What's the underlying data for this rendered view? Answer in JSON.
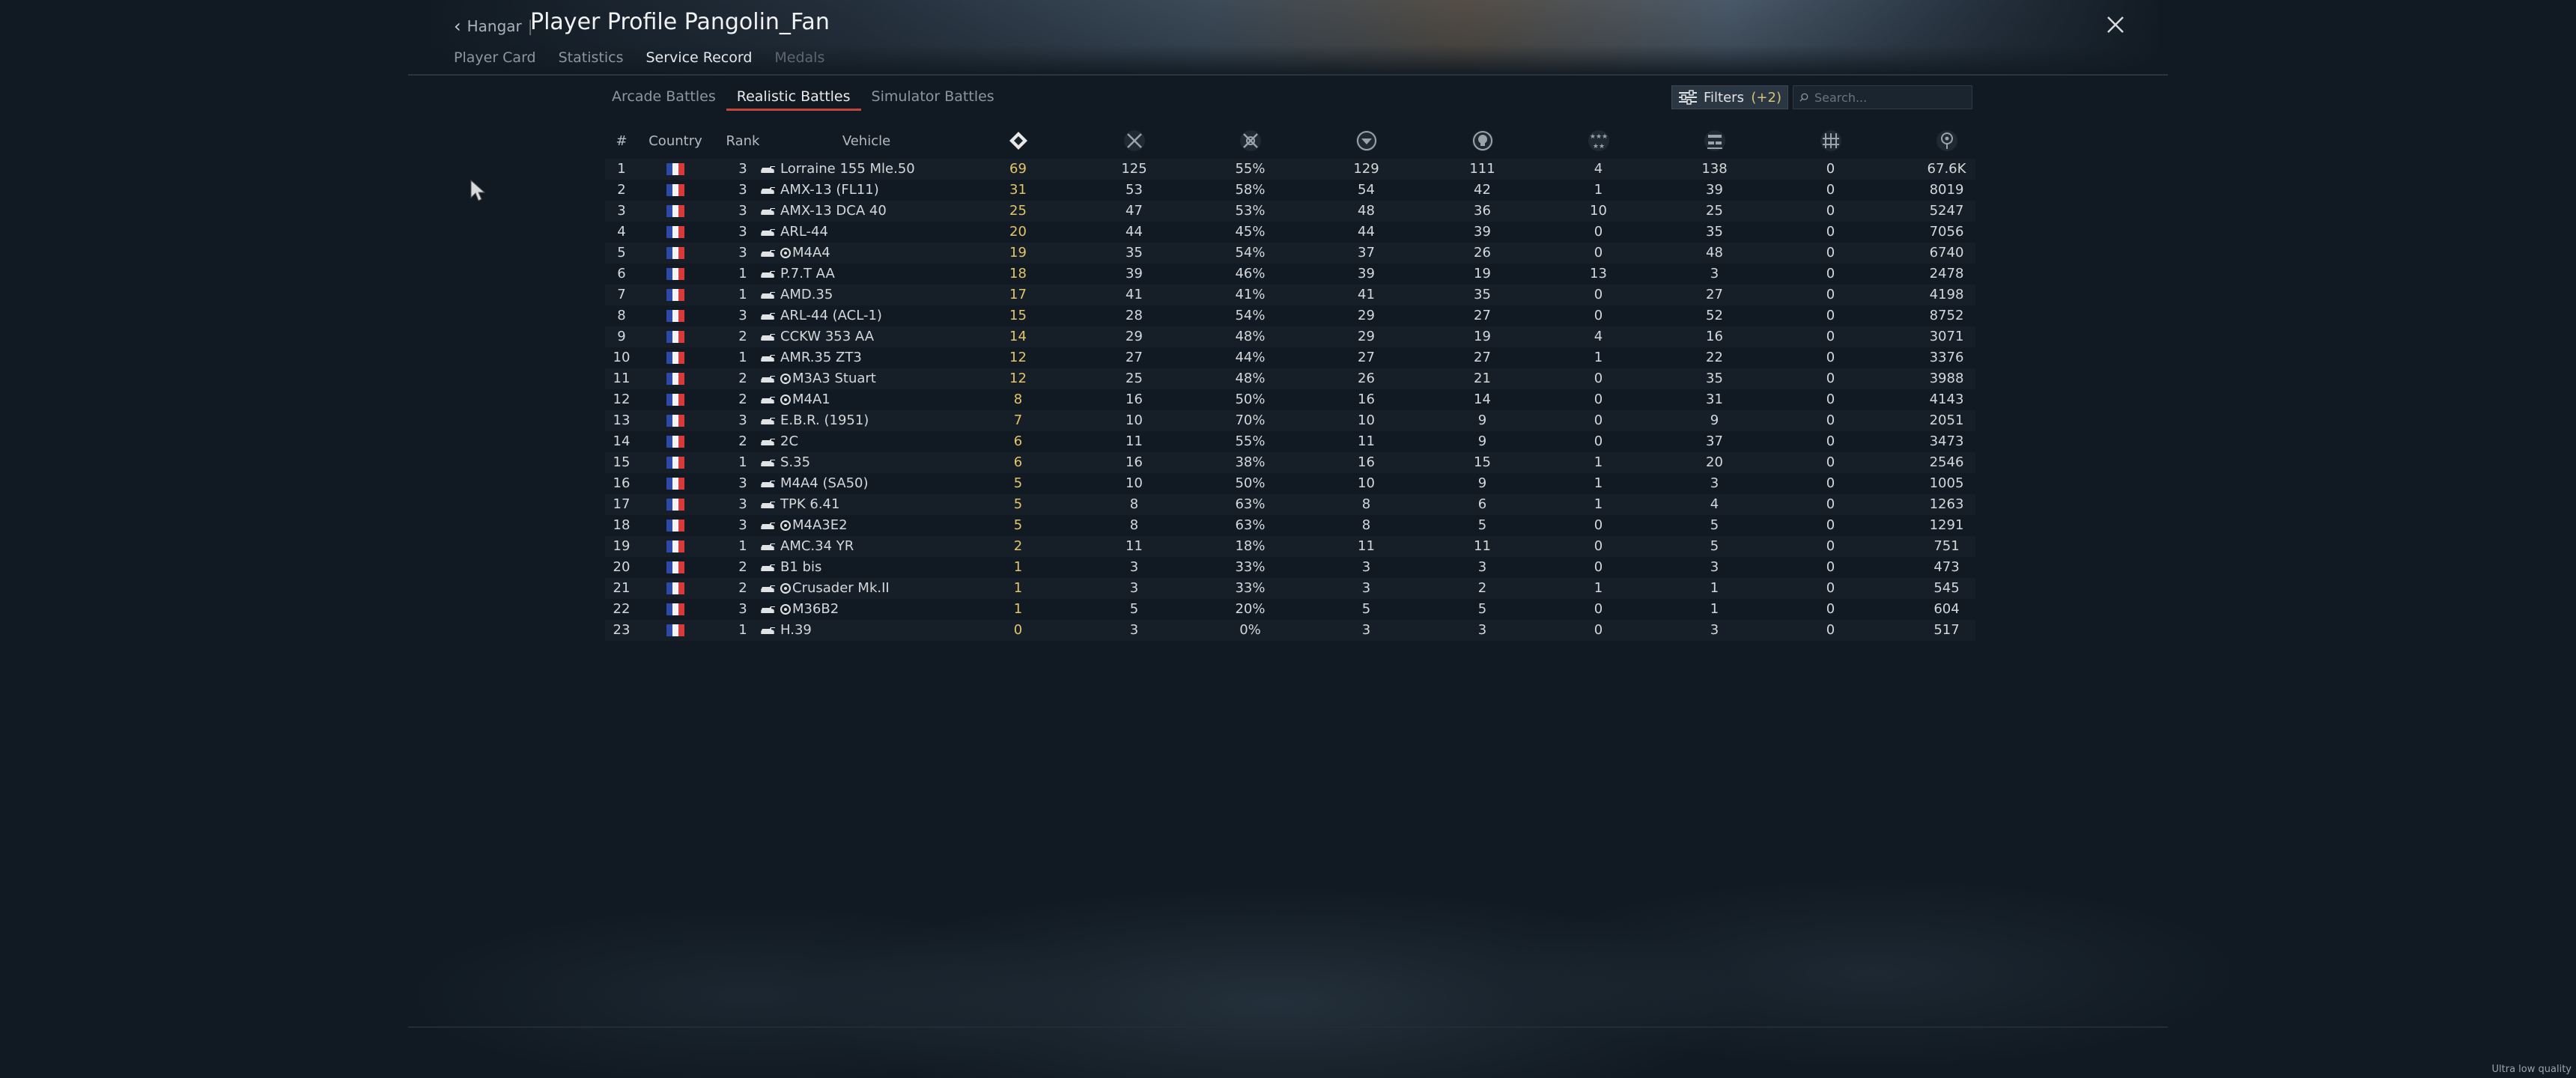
{
  "header": {
    "back_label": "Hangar",
    "title": "Player Profile Pangolin_Fan"
  },
  "tabs": [
    {
      "label": "Player Card",
      "state": "normal"
    },
    {
      "label": "Statistics",
      "state": "normal"
    },
    {
      "label": "Service Record",
      "state": "active"
    },
    {
      "label": "Medals",
      "state": "dim"
    }
  ],
  "battle_tabs": [
    {
      "label": "Arcade Battles",
      "active": false
    },
    {
      "label": "Realistic Battles",
      "active": true
    },
    {
      "label": "Simulator Battles",
      "active": false
    }
  ],
  "filters": {
    "label": "Filters",
    "count": "(+2)"
  },
  "search": {
    "placeholder": "Search..."
  },
  "table": {
    "headers": {
      "num": "#",
      "country": "Country",
      "rank": "Rank",
      "vehicle": "Vehicle"
    },
    "icon_columns": [
      "battles-icon",
      "victories-icon",
      "win-rate-icon",
      "respawns-icon",
      "deaths-icon",
      "air-kills-icon",
      "ground-kills-icon",
      "naval-kills-icon",
      "activity-icon"
    ],
    "rows": [
      {
        "num": "1",
        "rank": "3",
        "vehicle": "Lorraine 155 Mle.50",
        "premium": false,
        "battles": "69",
        "victories": "125",
        "win_rate": "55%",
        "respawns": "129",
        "deaths": "111",
        "air_kills": "4",
        "ground_kills": "138",
        "naval_kills": "0",
        "activity": "67.6K"
      },
      {
        "num": "2",
        "rank": "3",
        "vehicle": "AMX-13 (FL11)",
        "premium": false,
        "battles": "31",
        "victories": "53",
        "win_rate": "58%",
        "respawns": "54",
        "deaths": "42",
        "air_kills": "1",
        "ground_kills": "39",
        "naval_kills": "0",
        "activity": "8019"
      },
      {
        "num": "3",
        "rank": "3",
        "vehicle": "AMX-13 DCA 40",
        "premium": false,
        "battles": "25",
        "victories": "47",
        "win_rate": "53%",
        "respawns": "48",
        "deaths": "36",
        "air_kills": "10",
        "ground_kills": "25",
        "naval_kills": "0",
        "activity": "5247"
      },
      {
        "num": "4",
        "rank": "3",
        "vehicle": "ARL-44",
        "premium": false,
        "battles": "20",
        "victories": "44",
        "win_rate": "45%",
        "respawns": "44",
        "deaths": "39",
        "air_kills": "0",
        "ground_kills": "35",
        "naval_kills": "0",
        "activity": "7056"
      },
      {
        "num": "5",
        "rank": "3",
        "vehicle": "M4A4",
        "premium": true,
        "battles": "19",
        "victories": "35",
        "win_rate": "54%",
        "respawns": "37",
        "deaths": "26",
        "air_kills": "0",
        "ground_kills": "48",
        "naval_kills": "0",
        "activity": "6740"
      },
      {
        "num": "6",
        "rank": "1",
        "vehicle": "P.7.T AA",
        "premium": false,
        "battles": "18",
        "victories": "39",
        "win_rate": "46%",
        "respawns": "39",
        "deaths": "19",
        "air_kills": "13",
        "ground_kills": "3",
        "naval_kills": "0",
        "activity": "2478"
      },
      {
        "num": "7",
        "rank": "1",
        "vehicle": "AMD.35",
        "premium": false,
        "battles": "17",
        "victories": "41",
        "win_rate": "41%",
        "respawns": "41",
        "deaths": "35",
        "air_kills": "0",
        "ground_kills": "27",
        "naval_kills": "0",
        "activity": "4198"
      },
      {
        "num": "8",
        "rank": "3",
        "vehicle": "ARL-44 (ACL-1)",
        "premium": false,
        "battles": "15",
        "victories": "28",
        "win_rate": "54%",
        "respawns": "29",
        "deaths": "27",
        "air_kills": "0",
        "ground_kills": "52",
        "naval_kills": "0",
        "activity": "8752"
      },
      {
        "num": "9",
        "rank": "2",
        "vehicle": "CCKW 353 AA",
        "premium": false,
        "battles": "14",
        "victories": "29",
        "win_rate": "48%",
        "respawns": "29",
        "deaths": "19",
        "air_kills": "4",
        "ground_kills": "16",
        "naval_kills": "0",
        "activity": "3071"
      },
      {
        "num": "10",
        "rank": "1",
        "vehicle": "AMR.35 ZT3",
        "premium": false,
        "battles": "12",
        "victories": "27",
        "win_rate": "44%",
        "respawns": "27",
        "deaths": "27",
        "air_kills": "1",
        "ground_kills": "22",
        "naval_kills": "0",
        "activity": "3376"
      },
      {
        "num": "11",
        "rank": "2",
        "vehicle": "M3A3 Stuart",
        "premium": true,
        "battles": "12",
        "victories": "25",
        "win_rate": "48%",
        "respawns": "26",
        "deaths": "21",
        "air_kills": "0",
        "ground_kills": "35",
        "naval_kills": "0",
        "activity": "3988"
      },
      {
        "num": "12",
        "rank": "2",
        "vehicle": "M4A1",
        "premium": true,
        "battles": "8",
        "victories": "16",
        "win_rate": "50%",
        "respawns": "16",
        "deaths": "14",
        "air_kills": "0",
        "ground_kills": "31",
        "naval_kills": "0",
        "activity": "4143"
      },
      {
        "num": "13",
        "rank": "3",
        "vehicle": "E.B.R. (1951)",
        "premium": false,
        "battles": "7",
        "victories": "10",
        "win_rate": "70%",
        "respawns": "10",
        "deaths": "9",
        "air_kills": "0",
        "ground_kills": "9",
        "naval_kills": "0",
        "activity": "2051"
      },
      {
        "num": "14",
        "rank": "2",
        "vehicle": "2C",
        "premium": false,
        "battles": "6",
        "victories": "11",
        "win_rate": "55%",
        "respawns": "11",
        "deaths": "9",
        "air_kills": "0",
        "ground_kills": "37",
        "naval_kills": "0",
        "activity": "3473"
      },
      {
        "num": "15",
        "rank": "1",
        "vehicle": "S.35",
        "premium": false,
        "battles": "6",
        "victories": "16",
        "win_rate": "38%",
        "respawns": "16",
        "deaths": "15",
        "air_kills": "1",
        "ground_kills": "20",
        "naval_kills": "0",
        "activity": "2546"
      },
      {
        "num": "16",
        "rank": "3",
        "vehicle": "M4A4 (SA50)",
        "premium": false,
        "battles": "5",
        "victories": "10",
        "win_rate": "50%",
        "respawns": "10",
        "deaths": "9",
        "air_kills": "1",
        "ground_kills": "3",
        "naval_kills": "0",
        "activity": "1005"
      },
      {
        "num": "17",
        "rank": "3",
        "vehicle": "TPK 6.41",
        "premium": false,
        "battles": "5",
        "victories": "8",
        "win_rate": "63%",
        "respawns": "8",
        "deaths": "6",
        "air_kills": "1",
        "ground_kills": "4",
        "naval_kills": "0",
        "activity": "1263"
      },
      {
        "num": "18",
        "rank": "3",
        "vehicle": "M4A3E2",
        "premium": true,
        "battles": "5",
        "victories": "8",
        "win_rate": "63%",
        "respawns": "8",
        "deaths": "5",
        "air_kills": "0",
        "ground_kills": "5",
        "naval_kills": "0",
        "activity": "1291"
      },
      {
        "num": "19",
        "rank": "1",
        "vehicle": "AMC.34 YR",
        "premium": false,
        "battles": "2",
        "victories": "11",
        "win_rate": "18%",
        "respawns": "11",
        "deaths": "11",
        "air_kills": "0",
        "ground_kills": "5",
        "naval_kills": "0",
        "activity": "751"
      },
      {
        "num": "20",
        "rank": "2",
        "vehicle": "B1 bis",
        "premium": false,
        "battles": "1",
        "victories": "3",
        "win_rate": "33%",
        "respawns": "3",
        "deaths": "3",
        "air_kills": "0",
        "ground_kills": "3",
        "naval_kills": "0",
        "activity": "473"
      },
      {
        "num": "21",
        "rank": "2",
        "vehicle": "Crusader Mk.II",
        "premium": true,
        "battles": "1",
        "victories": "3",
        "win_rate": "33%",
        "respawns": "3",
        "deaths": "2",
        "air_kills": "1",
        "ground_kills": "1",
        "naval_kills": "0",
        "activity": "545"
      },
      {
        "num": "22",
        "rank": "3",
        "vehicle": "M36B2",
        "premium": true,
        "battles": "1",
        "victories": "5",
        "win_rate": "20%",
        "respawns": "5",
        "deaths": "5",
        "air_kills": "0",
        "ground_kills": "1",
        "naval_kills": "0",
        "activity": "604"
      },
      {
        "num": "23",
        "rank": "1",
        "vehicle": "H.39",
        "premium": false,
        "battles": "0",
        "victories": "3",
        "win_rate": "0%",
        "respawns": "3",
        "deaths": "3",
        "air_kills": "0",
        "ground_kills": "3",
        "naval_kills": "0",
        "activity": "517"
      }
    ]
  },
  "status": {
    "quality": "Ultra low quality"
  },
  "colors": {
    "accent_red": "#c0473a",
    "highlight_yellow": "#e3c56a",
    "flag_blue": "#2c48a8",
    "flag_white": "#f4f4f4",
    "flag_red": "#d63a3a"
  }
}
